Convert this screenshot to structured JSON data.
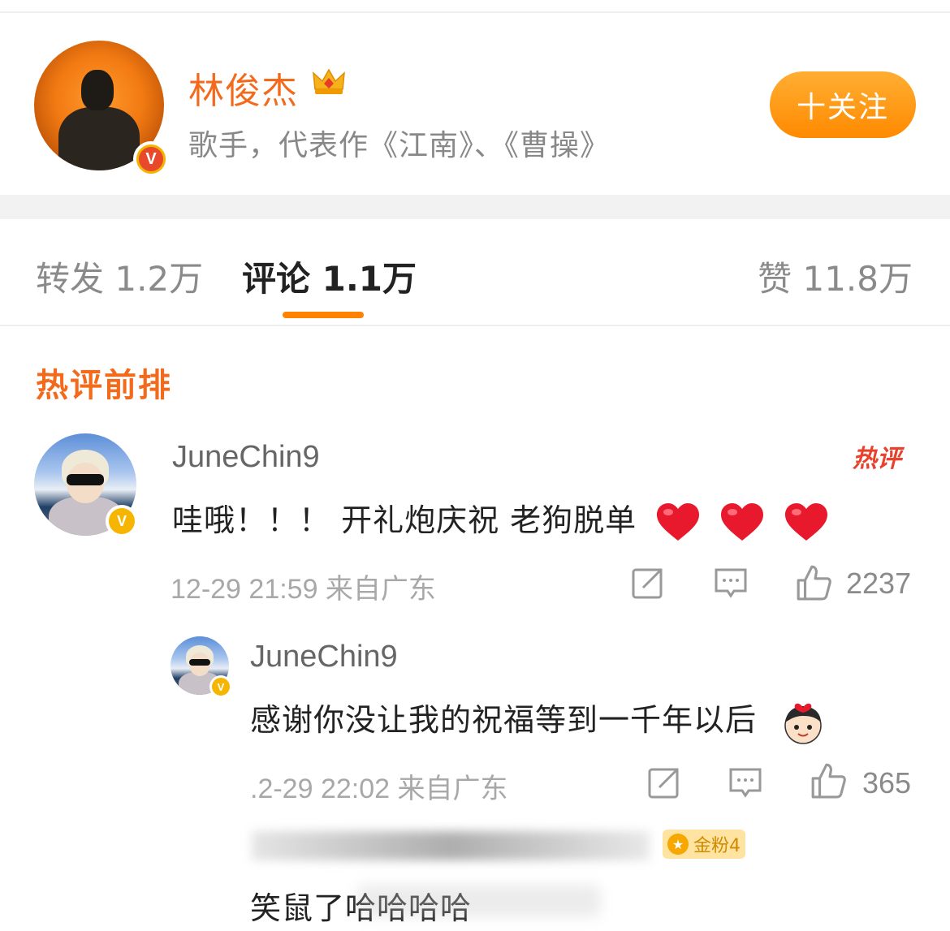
{
  "profile": {
    "name": "林俊杰",
    "description": "歌手，代表作《江南》、《曹操》",
    "follow_label": "十关注",
    "avatar_icon": "artist-avatar",
    "verified_icon": "verified-red-v-icon",
    "crown_icon": "crown-icon"
  },
  "tabs": {
    "repost": "转发 1.2万",
    "comment": "评论 1.1万",
    "like": "赞 11.8万",
    "active": "comment"
  },
  "section": {
    "title": "热评前排"
  },
  "comments": [
    {
      "user": "JuneChin9",
      "text": "哇哦！！！ 开礼炮庆祝 老狗脱单",
      "emoji": "❤️❤️❤️",
      "meta": "12-29 21:59 来自广东",
      "likes": "2237",
      "badge": "热评"
    },
    {
      "user": "JuneChin9",
      "text": "感谢你没让我的祝福等到一千年以后",
      "meta": ".2-29 22:02 来自广东",
      "likes": "365"
    },
    {
      "text": "笑鼠了哈哈哈哈",
      "fan_badge": "金粉4"
    }
  ],
  "colors": {
    "accent": "#ff8200",
    "name_orange": "#f26b1d",
    "hot_red": "#e8412c"
  }
}
